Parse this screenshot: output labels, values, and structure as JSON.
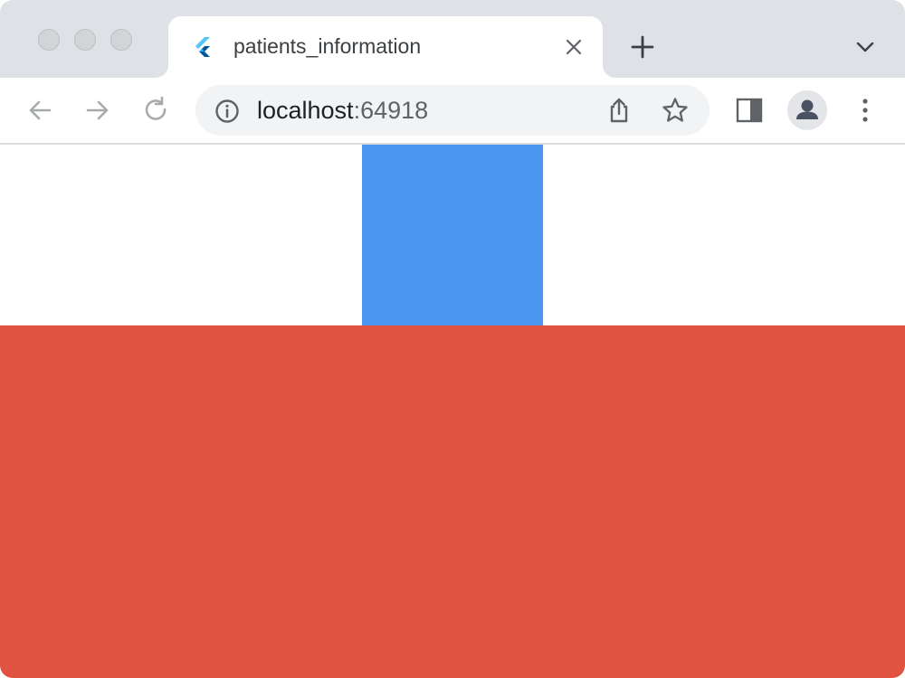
{
  "browser": {
    "window_controls": [
      "close",
      "minimize",
      "maximize"
    ],
    "tab": {
      "title": "patients_information",
      "favicon": "flutter-icon"
    },
    "toolbar": {
      "url_host": "localhost",
      "url_rest": ":64918",
      "icons": [
        "back-arrow-icon",
        "forward-arrow-icon",
        "reload-icon",
        "info-icon",
        "share-icon",
        "star-icon",
        "side-panel-icon",
        "profile-icon",
        "kebab-menu-icon"
      ]
    }
  },
  "page": {
    "blocks": [
      {
        "name": "blue-block",
        "color": "#4a96ee"
      },
      {
        "name": "red-block",
        "color": "#e05340"
      }
    ]
  },
  "colors": {
    "tabstrip": "#dee1e6",
    "omnibox": "#f1f3f4",
    "icon": "#5f6368",
    "icon_disabled": "#a8abae"
  }
}
